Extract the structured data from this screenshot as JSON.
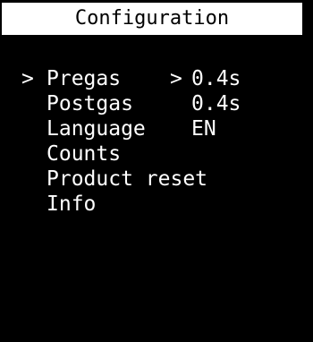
{
  "screen": {
    "title": "Configuration"
  },
  "menu": {
    "items": [
      {
        "cursor": ">",
        "label": "Pregas",
        "value_cursor": ">",
        "value": "0.4s"
      },
      {
        "cursor": "",
        "label": "Postgas",
        "value_cursor": "",
        "value": "0.4s"
      },
      {
        "cursor": "",
        "label": "Language",
        "value_cursor": "",
        "value": "EN"
      },
      {
        "cursor": "",
        "label": "Counts",
        "value_cursor": "",
        "value": ""
      },
      {
        "cursor": "",
        "label": "Product reset",
        "value_cursor": "",
        "value": ""
      },
      {
        "cursor": "",
        "label": "Info",
        "value_cursor": "",
        "value": ""
      }
    ]
  },
  "colors": {
    "background": "#000000",
    "foreground": "#ffffff",
    "title_background": "#ffffff",
    "title_text": "#000000"
  }
}
